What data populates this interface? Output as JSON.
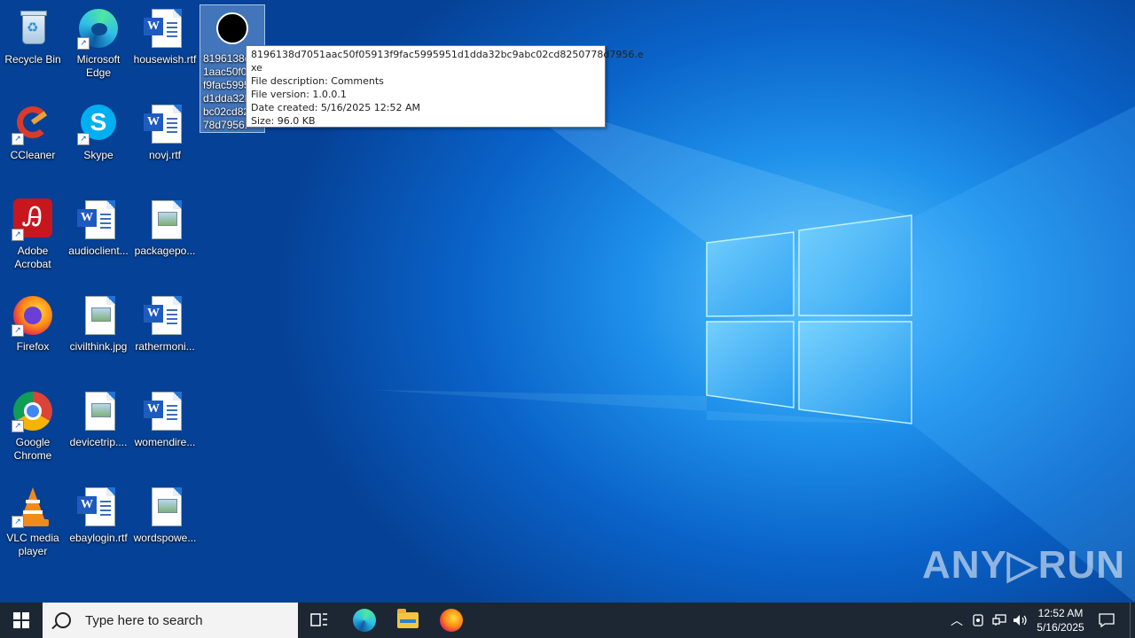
{
  "desktop_icons": [
    {
      "name": "recycle-bin",
      "label": "Recycle Bin"
    },
    {
      "name": "microsoft-edge",
      "label": "Microsoft Edge"
    },
    {
      "name": "housewish",
      "label": "housewish.rtf"
    },
    {
      "name": "selected-exe",
      "label": "8196138d7051aac50f05913f9fac5995951d1dda32bc9abc02cd8250778d7956.exe"
    },
    {
      "name": "ccleaner",
      "label": "CCleaner"
    },
    {
      "name": "skype",
      "label": "Skype"
    },
    {
      "name": "novj",
      "label": "novj.rtf"
    },
    {
      "name": "adobe-acrobat",
      "label": "Adobe Acrobat"
    },
    {
      "name": "audioclient",
      "label": "audioclient..."
    },
    {
      "name": "packagepo",
      "label": "packagepo..."
    },
    {
      "name": "firefox",
      "label": "Firefox"
    },
    {
      "name": "civilthink",
      "label": "civilthink.jpg"
    },
    {
      "name": "rathermoni",
      "label": "rathermoni..."
    },
    {
      "name": "google-chrome",
      "label": "Google Chrome"
    },
    {
      "name": "devicetrip",
      "label": "devicetrip...."
    },
    {
      "name": "womendire",
      "label": "womendire..."
    },
    {
      "name": "vlc",
      "label": "VLC media player"
    },
    {
      "name": "ebaylogin",
      "label": "ebaylogin.rtf"
    },
    {
      "name": "wordspowe",
      "label": "wordspowe..."
    }
  ],
  "selected_label_lines": [
    "8196138d",
    "1aac50f05",
    "f9fac5995",
    "d1dda32b",
    "bc02cd82",
    "78d7956."
  ],
  "tooltip": {
    "line1": "8196138d7051aac50f05913f9fac5995951d1dda32bc9abc02cd8250778d7956.e",
    "line2": "xe",
    "description": "File description: Comments",
    "version": "File version: 1.0.0.1",
    "created": "Date created: 5/16/2025 12:52 AM",
    "size": "Size: 96.0 KB"
  },
  "watermark": "ANY▷RUN",
  "taskbar": {
    "search_placeholder": "Type here to search",
    "time": "12:52 AM",
    "date": "5/16/2025"
  },
  "colors": {
    "taskbar": "#1c2733",
    "accent": "#0a63c9"
  }
}
